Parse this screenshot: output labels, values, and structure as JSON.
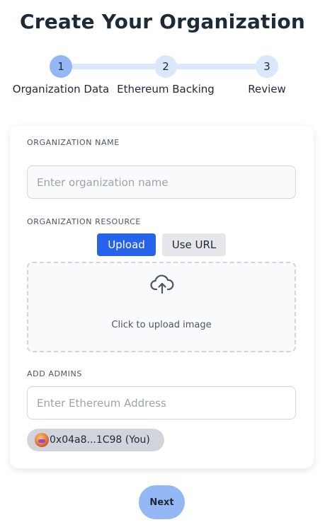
{
  "page": {
    "title": "Create Your Organization"
  },
  "stepper": {
    "steps": [
      {
        "number": "1",
        "label": "Organization Data",
        "active": true
      },
      {
        "number": "2",
        "label": "Ethereum Backing",
        "active": false
      },
      {
        "number": "3",
        "label": "Review",
        "active": false
      }
    ],
    "active_color": "#93b8f5",
    "inactive_color": "#dbe7fb"
  },
  "form": {
    "org_name": {
      "label": "ORGANIZATION NAME",
      "placeholder": "Enter organization name",
      "value": ""
    },
    "org_resource": {
      "label": "ORGANIZATION RESOURCE",
      "upload_label": "Upload",
      "use_url_label": "Use URL",
      "selected": "Upload",
      "upload_icon": "cloud-upload-icon",
      "upload_prompt": "Click to upload image"
    },
    "admins": {
      "label": "ADD ADMINS",
      "placeholder": "Enter Ethereum Address",
      "value": "",
      "list": [
        {
          "address": "0x04a8...1C98 (You)",
          "avatar_icon": "avatar"
        }
      ]
    }
  },
  "actions": {
    "next_label": "Next"
  },
  "colors": {
    "primary": "#2563eb",
    "secondary_button": "#e5e7eb",
    "chip": "#d1d5db"
  }
}
